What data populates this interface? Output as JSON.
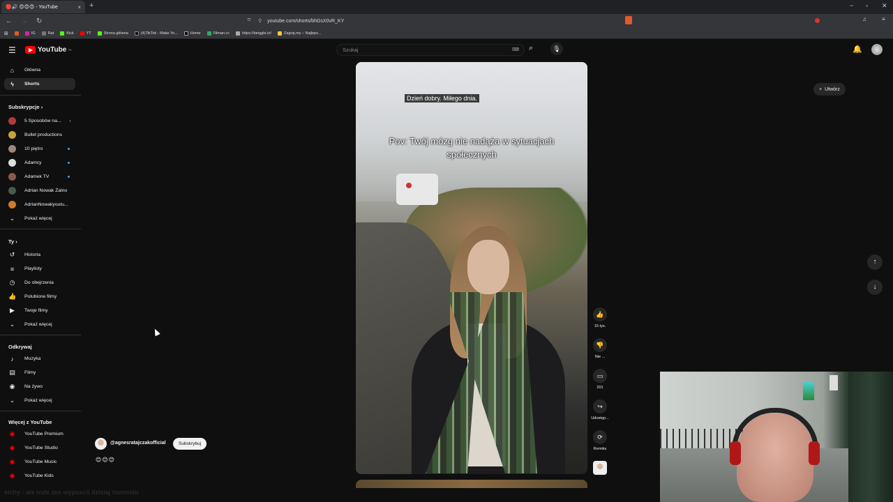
{
  "browser": {
    "tab_title": "🔴🔊 😊😊😊 - YouTube",
    "tab_close": "×",
    "new_tab": "+",
    "url": "youtube.com/shorts/bhGsX0vR_KY",
    "win_min": "−",
    "win_max": "▫",
    "win_close": "✕",
    "bookmarks": [
      "IG",
      "Rat",
      "Kick",
      "YT",
      "Strona główna",
      "(4)TikTok - Make Yo...",
      "Home",
      "Filman.cc",
      "https://tanggle.io/",
      "Zagraj.my – Najleps..."
    ]
  },
  "header": {
    "logo_text": "YouTube",
    "logo_region": "PL",
    "search_placeholder": "Szukaj",
    "create_label": "Utwórz"
  },
  "sidebar": {
    "main": [
      {
        "label": "Główna",
        "icon": "home-icon"
      },
      {
        "label": "Shorts",
        "icon": "shorts-icon"
      }
    ],
    "subs_title": "Subskrypcje",
    "subs": [
      {
        "label": "5 Sposobów na...",
        "color": "#b33a3a"
      },
      {
        "label": "Bullet productions",
        "color": "#c9a23a"
      },
      {
        "label": "10 piętro",
        "color": "#9a8a7a"
      },
      {
        "label": "Adamcy",
        "color": "#dddddd"
      },
      {
        "label": "Adamek TV",
        "color": "#8a5a4a"
      },
      {
        "label": "Adrian Nowak Żalno",
        "color": "#4a5a4a"
      },
      {
        "label": "AdrianNowakyoutu...",
        "color": "#d07a2a"
      }
    ],
    "subs_more": "Pokaż więcej",
    "you_title": "Ty",
    "you": [
      {
        "label": "Historia",
        "icon": "history-icon"
      },
      {
        "label": "Playlisty",
        "icon": "playlist-icon"
      },
      {
        "label": "Do obejrzenia",
        "icon": "watch-later-icon"
      },
      {
        "label": "Polubione filmy",
        "icon": "like-icon"
      },
      {
        "label": "Twoje filmy",
        "icon": "your-videos-icon"
      }
    ],
    "you_more": "Pokaż więcej",
    "explore_title": "Odkrywaj",
    "explore": [
      {
        "label": "Muzyka",
        "icon": "music-icon"
      },
      {
        "label": "Filmy",
        "icon": "movies-icon"
      },
      {
        "label": "Na żywo",
        "icon": "live-icon"
      }
    ],
    "explore_more": "Pokaż więcej",
    "more_title": "Więcej z YouTube",
    "more": [
      {
        "label": "YouTube Premium"
      },
      {
        "label": "YouTube Studio"
      },
      {
        "label": "YouTube Music"
      },
      {
        "label": "YouTube Kids"
      }
    ]
  },
  "short": {
    "caption_top": "Dzień dobry. Miłego dnia.",
    "caption_main": "Pov: Twój mózg nie nadąża w sytuacjach społecznych",
    "channel": "@agnesratajczakofficial",
    "subscribe": "Subskrybuj",
    "emoji": "😊😊😊",
    "likes": "15 tys.",
    "dislike": "Nie ...",
    "comments": "201",
    "share": "Udostęp...",
    "remix": "Remiks"
  },
  "overlay": {
    "ticker": "eichy : ale nute zes wypuscil dzisiaj homoslu"
  }
}
